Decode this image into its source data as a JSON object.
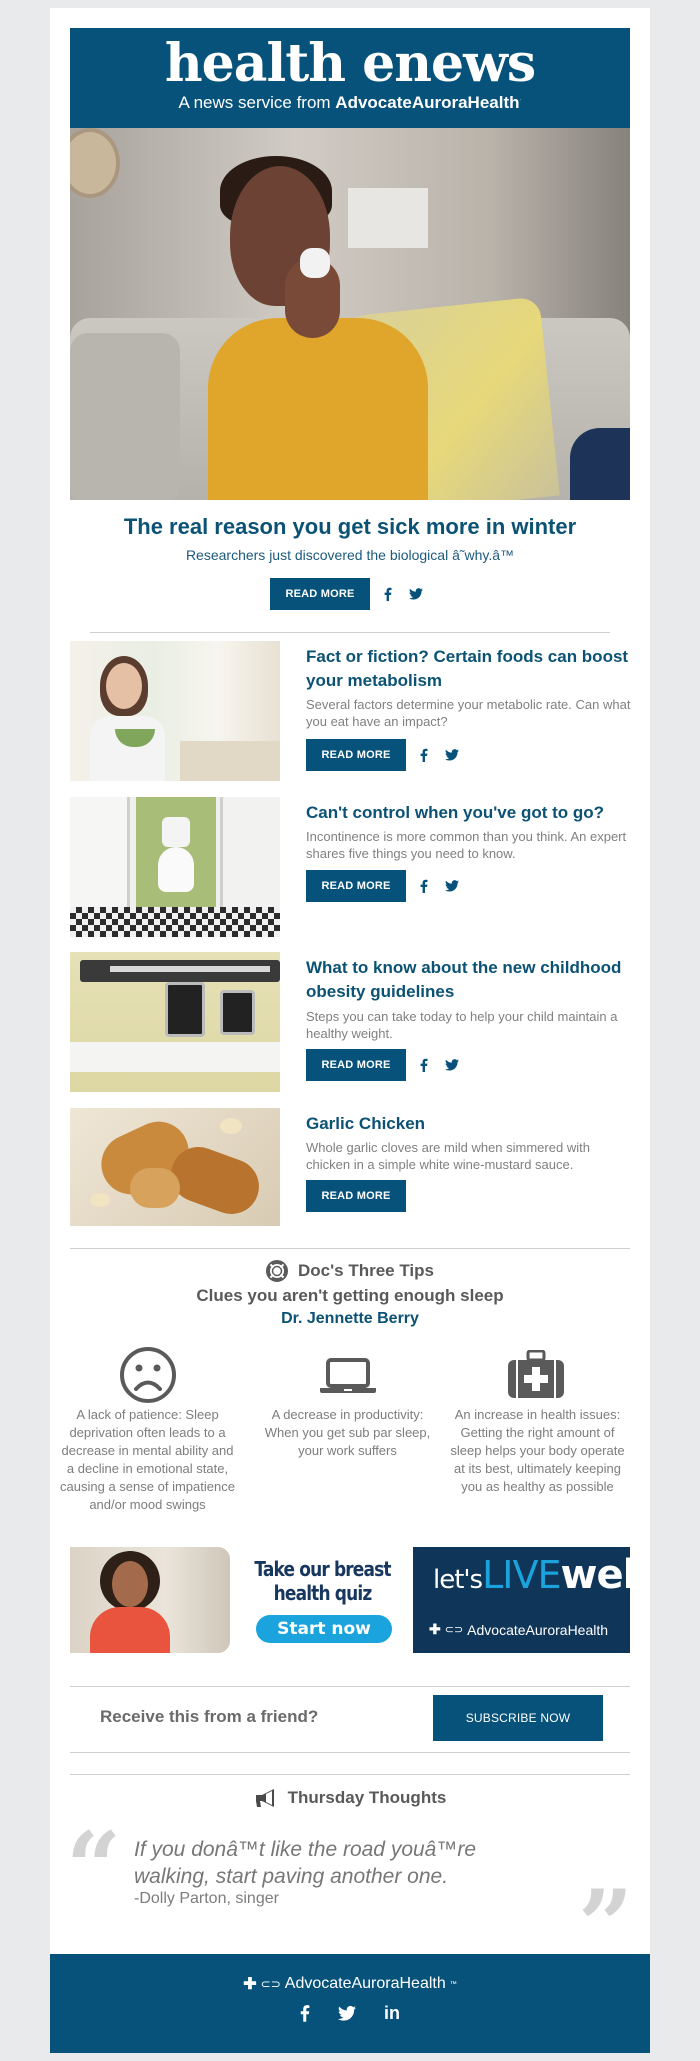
{
  "header": {
    "title": "health enews",
    "subtitle_prefix": "A news service from ",
    "subtitle_brand": "AdvocateAuroraHealth",
    "brand_color": "#06527a"
  },
  "hero": {
    "image_alt": "Woman sneezing into tissue on couch",
    "headline": "The real reason you get sick more in winter",
    "subline": "Researchers just discovered the biological â˜why.â™",
    "read_more": "READ MORE",
    "share": [
      "facebook-icon",
      "twitter-icon"
    ]
  },
  "articles": [
    {
      "image_alt": "Woman eating salad",
      "title": "Fact or fiction? Certain foods can boost your metabolism",
      "description": "Several factors determine your metabolic rate. Can what you eat have an impact?",
      "read_more": "READ MORE",
      "share": true
    },
    {
      "image_alt": "Bathroom stall with toilet",
      "title": "Can't control when you've got to go?",
      "description": "Incontinence is more common than you think. An expert shares five things you need to know.",
      "read_more": "READ MORE",
      "share": true
    },
    {
      "image_alt": "Doctor's scale",
      "title": "What to know about the new childhood obesity guidelines",
      "description": "Steps you can take today to help your child maintain a healthy weight.",
      "read_more": "READ MORE",
      "share": true
    },
    {
      "image_alt": "Garlic chicken dish",
      "title": "Garlic Chicken",
      "description": "Whole garlic cloves are mild when simmered with chicken in a simple white wine-mustard sauce.",
      "read_more": "READ MORE",
      "share": false
    }
  ],
  "tips": {
    "section_title": "Doc's Three Tips",
    "section_icon": "life-ring-icon",
    "subtitle": "Clues you aren't getting enough sleep",
    "doctor": "Dr. Jennette Berry",
    "items": [
      {
        "icon": "frown-face-icon",
        "text": "A lack of patience: Sleep deprivation often leads to a decrease in mental ability and a decline in emotional state, causing a sense of impatience and/or mood swings"
      },
      {
        "icon": "laptop-icon",
        "text": "A decrease in productivity: When you get sub par sleep, your work suffers"
      },
      {
        "icon": "medical-kit-icon",
        "text": "An increase in health issues: Getting the right amount of sleep helps your body operate at its best, ultimately keeping you as healthy as possible"
      }
    ]
  },
  "banner": {
    "headline_line1": "Take our breast",
    "headline_line2": "health quiz",
    "cta": "Start now",
    "tagline_lets": "let's",
    "tagline_live": "LIVE",
    "tagline_well": "well",
    "brand": "AdvocateAuroraHealth",
    "navy": "#0f3558",
    "sky": "#1aa3dd"
  },
  "subscribe": {
    "prompt": "Receive this from a friend?",
    "button": "SUBSCRIBE NOW"
  },
  "thoughts": {
    "section_title": "Thursday Thoughts",
    "section_icon": "megaphone-icon",
    "quote": "If you donâ™t like the road youâ™re walking, start paving another one.",
    "author": "-Dolly Parton, singer"
  },
  "footer": {
    "brand": "AdvocateAuroraHealth",
    "brand_mark": "™",
    "social": [
      "facebook-icon",
      "twitter-icon",
      "linkedin-icon"
    ]
  }
}
